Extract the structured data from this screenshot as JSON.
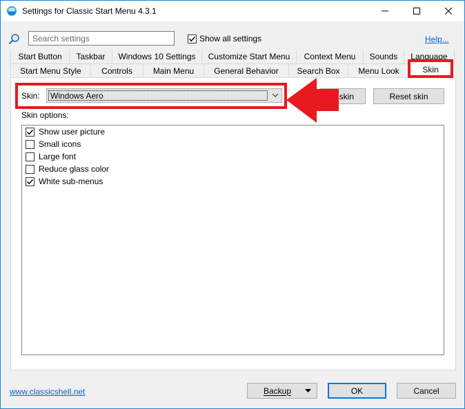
{
  "window": {
    "title": "Settings for Classic Start Menu 4.3.1"
  },
  "toolbar": {
    "search_placeholder": "Search settings",
    "show_all_label": "Show all settings",
    "show_all_checked": true,
    "help_label": "Help..."
  },
  "tabs": {
    "row1": [
      "Start Button",
      "Taskbar",
      "Windows 10 Settings",
      "Customize Start Menu",
      "Context Menu",
      "Sounds",
      "Language"
    ],
    "row2": [
      "Start Menu Style",
      "Controls",
      "Main Menu",
      "General Behavior",
      "Search Box",
      "Menu Look",
      "Skin"
    ],
    "active": "Skin"
  },
  "skin": {
    "label": "Skin:",
    "selected": "Windows Aero",
    "about_button": "skin",
    "reset_button": "Reset skin",
    "options_label": "Skin options:",
    "options": [
      {
        "label": "Show user picture",
        "checked": true
      },
      {
        "label": "Small icons",
        "checked": false
      },
      {
        "label": "Large font",
        "checked": false
      },
      {
        "label": "Reduce glass color",
        "checked": false
      },
      {
        "label": "White sub-menus",
        "checked": true
      }
    ]
  },
  "footer": {
    "link": "www.classicshell.net",
    "backup_button": "Backup",
    "ok_button": "OK",
    "cancel_button": "Cancel"
  },
  "colors": {
    "highlight": "#e8191f",
    "link": "#0066cc",
    "accent": "#0078d7"
  },
  "icons": [
    "app-icon",
    "minimize-icon",
    "maximize-icon",
    "close-icon",
    "search-icon",
    "check-icon",
    "chevron-down-icon",
    "arrow-left-icon"
  ]
}
